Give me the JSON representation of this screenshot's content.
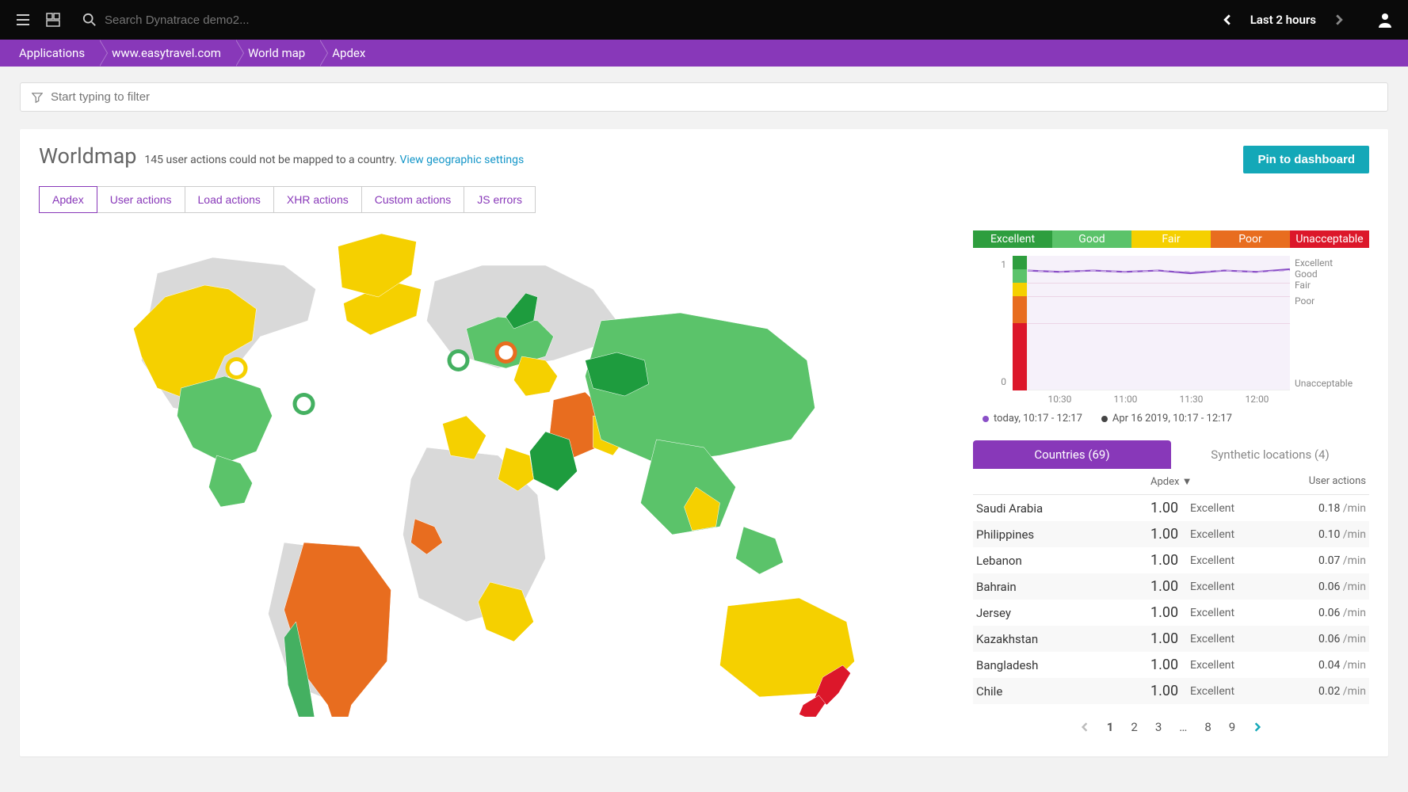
{
  "header": {
    "search_placeholder": "Search Dynatrace demo2...",
    "time_range": "Last 2 hours"
  },
  "breadcrumb": [
    "Applications",
    "www.easytravel.com",
    "World map",
    "Apdex"
  ],
  "filter": {
    "placeholder": "Start typing to filter"
  },
  "page": {
    "title": "Worldmap",
    "unmapped_text": "145 user actions could not be mapped to a country.",
    "settings_link": "View geographic settings",
    "pin_button": "Pin to dashboard"
  },
  "tabs": [
    "Apdex",
    "User actions",
    "Load actions",
    "XHR actions",
    "Custom actions",
    "JS errors"
  ],
  "active_tab": 0,
  "legend": [
    {
      "label": "Excellent",
      "color": "#2e9e3e"
    },
    {
      "label": "Good",
      "color": "#5bc36a"
    },
    {
      "label": "Fair",
      "color": "#f5d000"
    },
    {
      "label": "Poor",
      "color": "#e86d1f"
    },
    {
      "label": "Unacceptable",
      "color": "#dc172a"
    }
  ],
  "chart_data": {
    "type": "line",
    "ylim": [
      0,
      1
    ],
    "x_ticks": [
      "10:30",
      "11:00",
      "11:30",
      "12:00"
    ],
    "bands": [
      {
        "name": "Excellent",
        "from": 0.9,
        "to": 1.0
      },
      {
        "name": "Good",
        "from": 0.8,
        "to": 0.9
      },
      {
        "name": "Fair",
        "from": 0.7,
        "to": 0.8
      },
      {
        "name": "Poor",
        "from": 0.5,
        "to": 0.7
      },
      {
        "name": "Unacceptable",
        "from": 0.0,
        "to": 0.5
      }
    ],
    "series": [
      {
        "name": "today, 10:17 - 12:17",
        "color": "#8a4fc7",
        "x": [
          "10:17",
          "10:30",
          "10:45",
          "11:00",
          "11:15",
          "11:30",
          "11:45",
          "12:00",
          "12:17"
        ],
        "values": [
          0.9,
          0.89,
          0.9,
          0.89,
          0.9,
          0.88,
          0.9,
          0.89,
          0.91
        ]
      },
      {
        "name": "Apr 16 2019, 10:17 - 12:17",
        "color": "#454545",
        "x": [
          "10:17",
          "10:30",
          "10:45",
          "11:00",
          "11:15",
          "11:30",
          "11:45",
          "12:00",
          "12:17"
        ],
        "values": [
          0.9,
          0.89,
          0.9,
          0.89,
          0.9,
          0.89,
          0.9,
          0.89,
          0.9
        ]
      }
    ]
  },
  "chart_legend_items": [
    "today, 10:17 - 12:17",
    "Apr 16 2019, 10:17 - 12:17"
  ],
  "data_tabs": {
    "countries": "Countries (69)",
    "synthetic": "Synthetic locations (4)"
  },
  "table": {
    "col_country": "",
    "col_apdex": "Apdex ▼",
    "col_ua": "User actions",
    "rows": [
      {
        "country": "Saudi Arabia",
        "apdex": "1.00",
        "rating": "Excellent",
        "ua": "0.18",
        "unit": "/min"
      },
      {
        "country": "Philippines",
        "apdex": "1.00",
        "rating": "Excellent",
        "ua": "0.10",
        "unit": "/min"
      },
      {
        "country": "Lebanon",
        "apdex": "1.00",
        "rating": "Excellent",
        "ua": "0.07",
        "unit": "/min"
      },
      {
        "country": "Bahrain",
        "apdex": "1.00",
        "rating": "Excellent",
        "ua": "0.06",
        "unit": "/min"
      },
      {
        "country": "Jersey",
        "apdex": "1.00",
        "rating": "Excellent",
        "ua": "0.06",
        "unit": "/min"
      },
      {
        "country": "Kazakhstan",
        "apdex": "1.00",
        "rating": "Excellent",
        "ua": "0.06",
        "unit": "/min"
      },
      {
        "country": "Bangladesh",
        "apdex": "1.00",
        "rating": "Excellent",
        "ua": "0.04",
        "unit": "/min"
      },
      {
        "country": "Chile",
        "apdex": "1.00",
        "rating": "Excellent",
        "ua": "0.02",
        "unit": "/min"
      }
    ]
  },
  "pagination": {
    "pages": [
      "1",
      "2",
      "3",
      "…",
      "8",
      "9"
    ],
    "current": 1
  },
  "map_colors": {
    "none": "#d9d9d9",
    "excellent": "#44b061",
    "darkexcellent": "#1e9c3e",
    "good": "#9fd976",
    "fair": "#f5d000",
    "poor": "#e86d1f",
    "unacceptable": "#dc172a"
  }
}
